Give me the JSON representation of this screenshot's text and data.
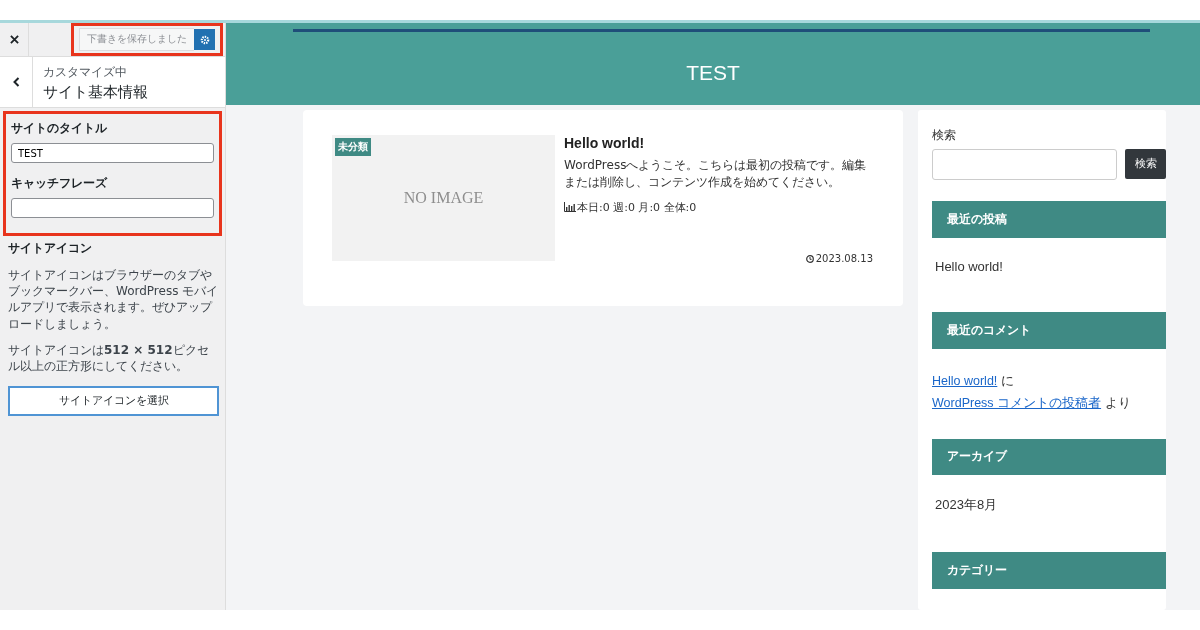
{
  "customizer": {
    "save_status": "下書きを保存しました",
    "breadcrumb": "カスタマイズ中",
    "section_title": "サイト基本情報",
    "fields": [
      {
        "label": "サイトのタイトル",
        "value": "TEST"
      },
      {
        "label": "キャッチフレーズ"
      }
    ],
    "site_icon": {
      "heading": "サイトアイコン",
      "paragraphs": [
        "サイトアイコンはブラウザーのタブやブックマークバー、WordPress モバイルアプリで表示されます。ぜひアップロードしましょう。",
        "サイトアイコンは**512 × 512**ピクセル以上の正方形にしてください。"
      ],
      "button": "サイトアイコンを選択"
    }
  },
  "preview": {
    "site_title": "TEST",
    "post": {
      "category": "未分類",
      "image_text": "NO IMAGE",
      "title": "Hello world!",
      "excerpt": "WordPressへようこそ。こちらは最初の投稿です。編集または削除し、コンテンツ作成を始めてください。",
      "stats": "本日:0 週:0 月:0 全体:0",
      "date": "2023.08.13"
    },
    "sidebar": {
      "search_label": "検索",
      "search_button": "検索",
      "widgets": [
        {
          "kind": "list",
          "title": "最近の投稿",
          "items": [
            "Hello world!"
          ]
        },
        {
          "kind": "comment",
          "title": "最近のコメント",
          "post_link": "Hello world!",
          "joiner": "に",
          "author_link": "WordPress コメントの投稿者",
          "suffix": "より"
        },
        {
          "kind": "list",
          "title": "アーカイブ",
          "items": [
            "2023年8月"
          ]
        },
        {
          "kind": "list",
          "title": "カテゴリー"
        }
      ]
    }
  }
}
